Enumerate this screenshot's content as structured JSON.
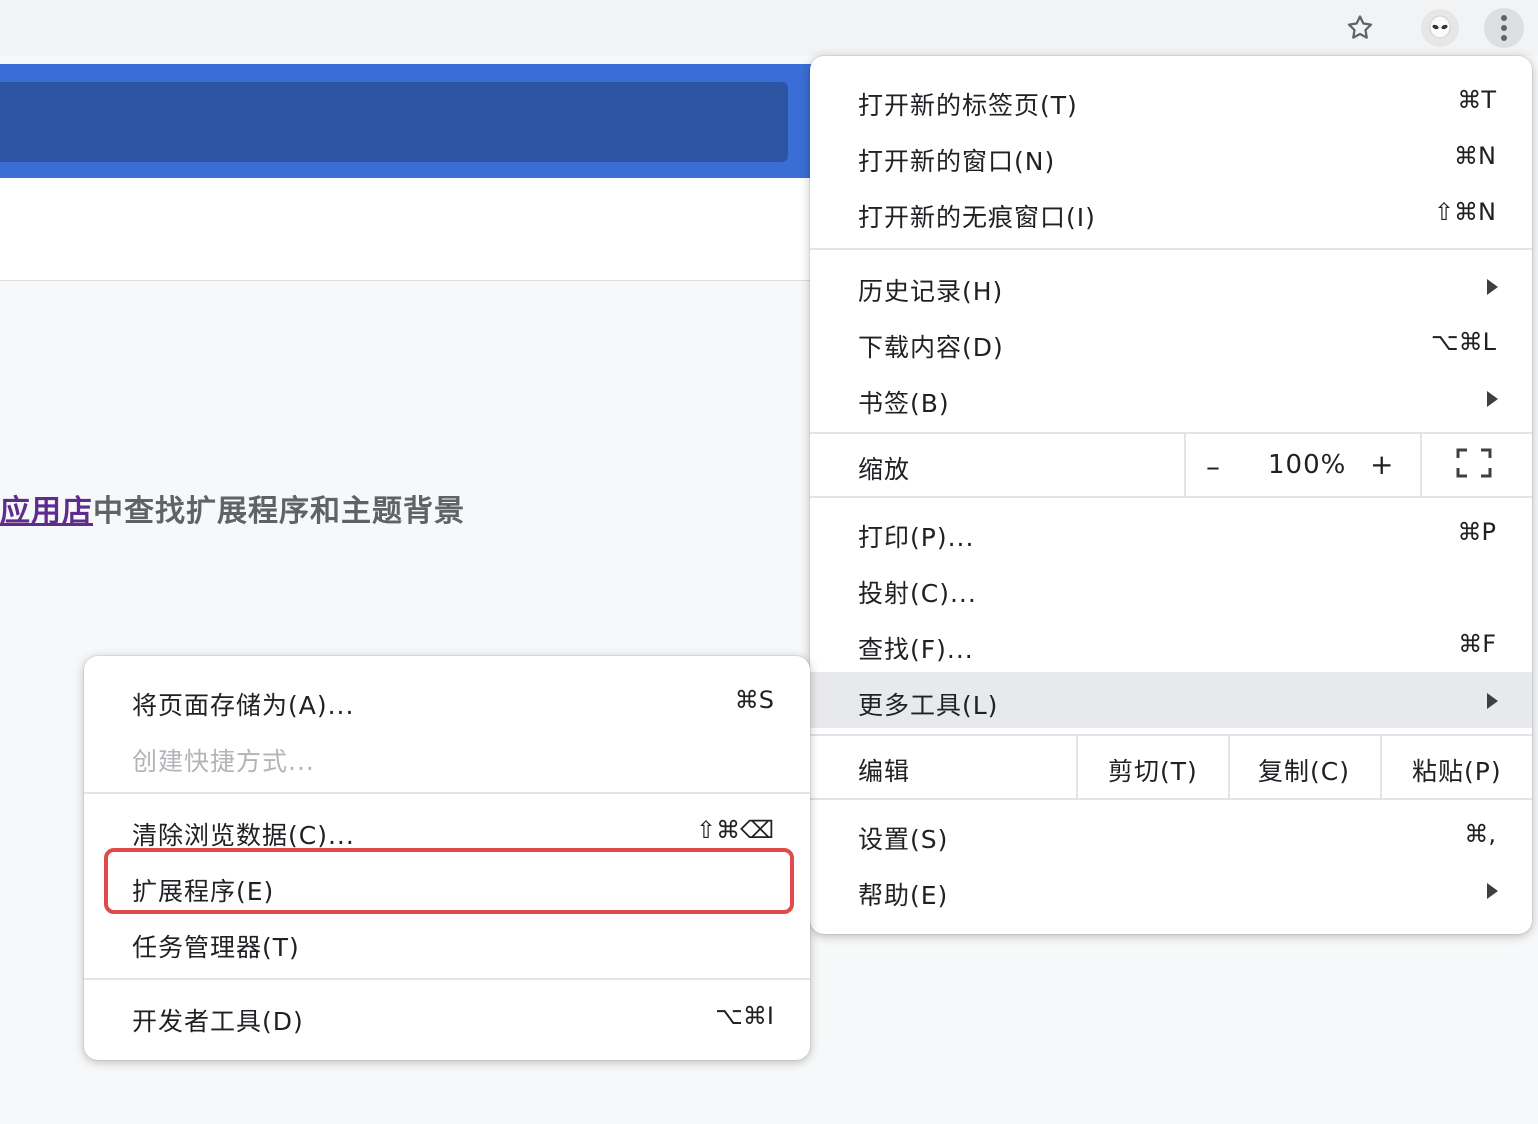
{
  "toolbar": {
    "star_icon": "star-outline-icon",
    "avatar_icon": "alien-avatar-icon",
    "menu_icon": "vertical-dots-icon"
  },
  "page": {
    "link_text": "应用店",
    "text": "中查找扩展程序和主题背景",
    "link_color": "#5e2c8c"
  },
  "main_menu": {
    "new_tab": {
      "label": "打开新的标签页(T)",
      "shortcut": "⌘T"
    },
    "new_window": {
      "label": "打开新的窗口(N)",
      "shortcut": "⌘N"
    },
    "new_incognito": {
      "label": "打开新的无痕窗口(I)",
      "shortcut": "⇧⌘N"
    },
    "history": {
      "label": "历史记录(H)"
    },
    "downloads": {
      "label": "下载内容(D)",
      "shortcut": "⌥⌘L"
    },
    "bookmarks": {
      "label": "书签(B)"
    },
    "zoom": {
      "label": "缩放",
      "minus": "–",
      "value": "100%",
      "plus": "+"
    },
    "print": {
      "label": "打印(P)...",
      "shortcut": "⌘P"
    },
    "cast": {
      "label": "投射(C)..."
    },
    "find": {
      "label": "查找(F)...",
      "shortcut": "⌘F"
    },
    "more_tools": {
      "label": "更多工具(L)"
    },
    "edit": {
      "label": "编辑",
      "cut": "剪切(T)",
      "copy": "复制(C)",
      "paste": "粘贴(P)"
    },
    "settings": {
      "label": "设置(S)",
      "shortcut": "⌘,"
    },
    "help": {
      "label": "帮助(E)"
    }
  },
  "sub_menu": {
    "save_page": {
      "label": "将页面存储为(A)...",
      "shortcut": "⌘S"
    },
    "create_shortcut": {
      "label": "创建快捷方式..."
    },
    "clear_data": {
      "label": "清除浏览数据(C)...",
      "shortcut": "⇧⌘⌫"
    },
    "extensions": {
      "label": "扩展程序(E)"
    },
    "task_manager": {
      "label": "任务管理器(T)"
    },
    "dev_tools": {
      "label": "开发者工具(D)",
      "shortcut": "⌥⌘I"
    }
  },
  "colors": {
    "accent_blue": "#3a6ed6",
    "highlight_box": "#e14a4a"
  }
}
